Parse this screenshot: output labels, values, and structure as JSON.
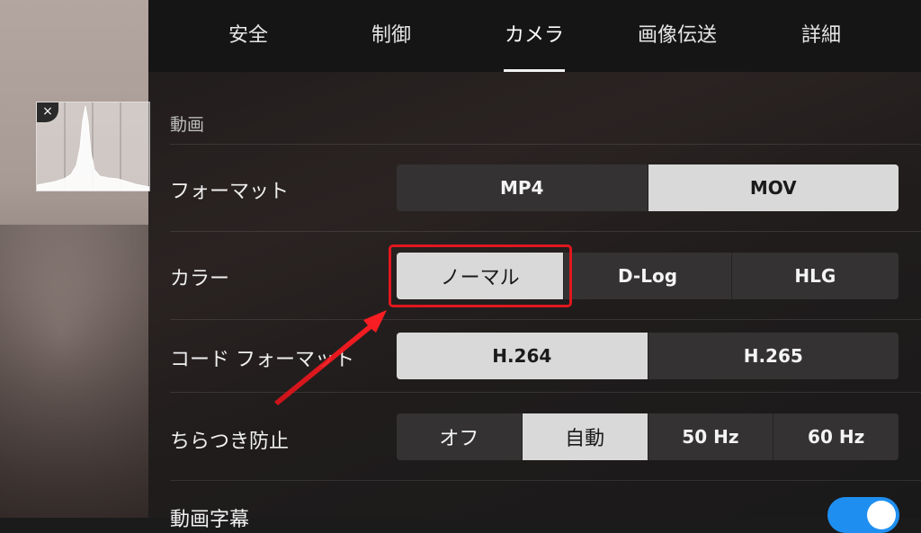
{
  "tabs": [
    {
      "label": "安全"
    },
    {
      "label": "制御"
    },
    {
      "label": "カメラ"
    },
    {
      "label": "画像伝送"
    },
    {
      "label": "詳細"
    }
  ],
  "active_tab": "カメラ",
  "histogram": {
    "close_glyph": "×"
  },
  "section": {
    "title": "動画"
  },
  "rows": {
    "format": {
      "label": "フォーマット",
      "options": [
        "MP4",
        "MOV"
      ],
      "selected": "MOV"
    },
    "color": {
      "label": "カラー",
      "options": [
        "ノーマル",
        "D-Log",
        "HLG"
      ],
      "selected": "ノーマル"
    },
    "codec": {
      "label": "コード フォーマット",
      "options": [
        "H.264",
        "H.265"
      ],
      "selected": "H.264"
    },
    "flicker": {
      "label": "ちらつき防止",
      "options": [
        "オフ",
        "自動",
        "50 Hz",
        "60 Hz"
      ],
      "selected": "自動"
    },
    "subtitle": {
      "label": "動画字幕",
      "toggle_on": true
    }
  },
  "colors": {
    "accent": "#1e8ff0",
    "highlight": "#e0171f",
    "selected_bg": "#d9d9d9"
  },
  "icons": {
    "histogram_close": "close-icon",
    "annotation_arrow": "arrow-icon"
  }
}
